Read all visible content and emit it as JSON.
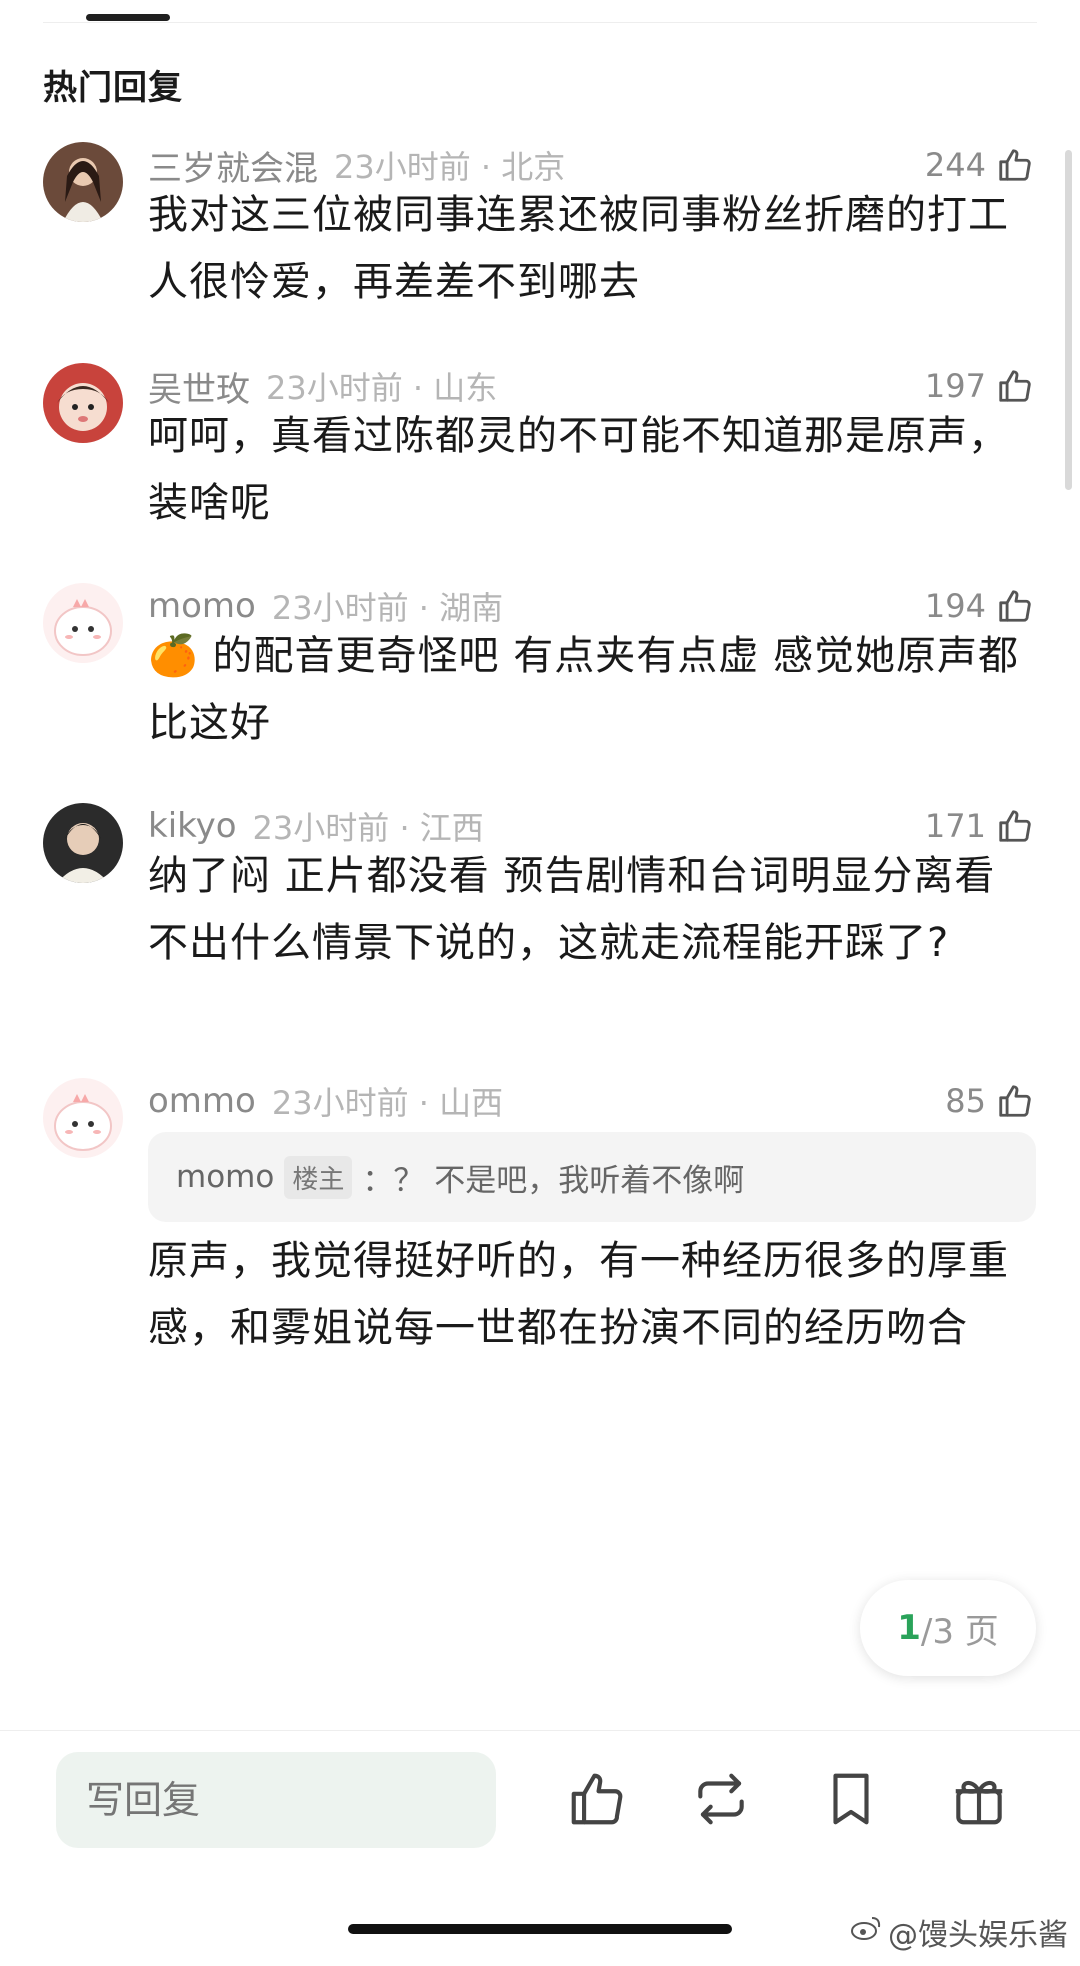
{
  "section_title": "热门回复",
  "comments": [
    {
      "username": "三岁就会混",
      "meta": "23小时前 · 北京",
      "likes": "244",
      "text": "我对这三位被同事连累还被同事粉丝折磨的打工人很怜爱，再差差不到哪去"
    },
    {
      "username": "吴世玫",
      "meta": "23小时前 · 山东",
      "likes": "197",
      "text": "呵呵，真看过陈都灵的不可能不知道那是原声，装啥呢"
    },
    {
      "username": "momo",
      "meta": "23小时前 · 湖南",
      "likes": "194",
      "emoji": "🍊",
      "text": "的配音更奇怪吧 有点夹有点虚 感觉她原声都比这好"
    },
    {
      "username": "kikyo",
      "meta": "23小时前 · 江西",
      "likes": "171",
      "text": "纳了闷 正片都没看 预告剧情和台词明显分离看不出什么情景下说的，这就走流程能开踩了?"
    },
    {
      "username": "ommo",
      "meta": "23小时前 · 山西",
      "likes": "85",
      "quote": {
        "username": "momo",
        "badge": "楼主",
        "text": "：？ 不是吧，我听着不像啊"
      },
      "text": "原声，我觉得挺好听的，有一种经历很多的厚重感，和雾姐说每一世都在扮演不同的经历吻合"
    }
  ],
  "pager": {
    "current": "1",
    "total": "/3 页"
  },
  "bottom_bar": {
    "reply_placeholder": "写回复"
  },
  "watermark": "@馒头娱乐酱",
  "colors": {
    "accent": "#2aa35a",
    "input_bg": "#edf3ef"
  }
}
